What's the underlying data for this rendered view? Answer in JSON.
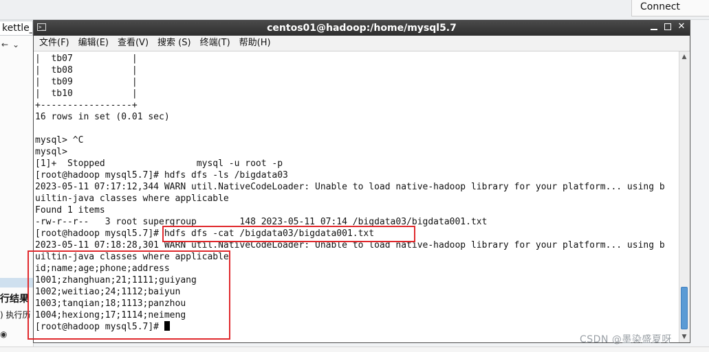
{
  "background_app": {
    "connect_label": "Connect",
    "tab_label": "kettle_",
    "result_label": "行结果",
    "history_label": ") 执行历",
    "tool_icons": [
      "arrow-left-icon",
      "chevron-down-icon"
    ]
  },
  "watermark": "CSDN @墨染盛夏呀",
  "terminal": {
    "title": "centos01@hadoop:/home/mysql5.7",
    "menu": [
      "文件(F)",
      "编辑(E)",
      "查看(V)",
      "搜索 (S)",
      "终端(T)",
      "帮助(H)"
    ],
    "lines": [
      "|  tb07           |",
      "|  tb08           |",
      "|  tb09           |",
      "|  tb10           |",
      "+-----------------+",
      "16 rows in set (0.01 sec)",
      "",
      "mysql> ^C",
      "mysql>",
      "[1]+  Stopped                 mysql -u root -p",
      "[root@hadoop mysql5.7]# hdfs dfs -ls /bigdata03",
      "2023-05-11 07:17:12,344 WARN util.NativeCodeLoader: Unable to load native-hadoop library for your platform... using b",
      "uiltin-java classes where applicable",
      "Found 1 items",
      "-rw-r--r--   3 root supergroup        148 2023-05-11 07:14 /bigdata03/bigdata001.txt",
      "[root@hadoop mysql5.7]# hdfs dfs -cat /bigdata03/bigdata001.txt",
      "2023-05-11 07:18:28,301 WARN util.NativeCodeLoader: Unable to load native-hadoop library for your platform... using b",
      "uiltin-java classes where applicable",
      "id;name;age;phone;address",
      "1001;zhanghuan;21;1111;guiyang",
      "1002;weitiao;24;1112;baiyun",
      "1003;tanqian;18;1113;panzhou",
      "1004;hexiong;17;1114;neimeng"
    ],
    "prompt": "[root@hadoop mysql5.7]# "
  },
  "colors": {
    "highlight": "#e0282c",
    "scroll_thumb": "#5b9bd5",
    "titlebar": "#333333"
  }
}
